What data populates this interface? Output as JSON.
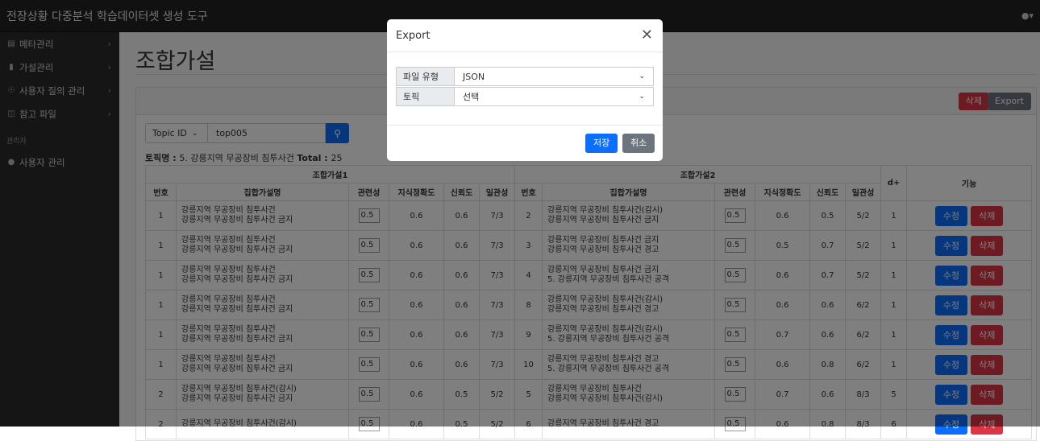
{
  "app": {
    "title": "전장상황 다중분석 학습데이터셋 생성 도구",
    "user_icon": "user-icon"
  },
  "sidebar": {
    "items": [
      {
        "label": "메타관리",
        "icon": "list-icon"
      },
      {
        "label": "가설관리",
        "icon": "bars-icon"
      },
      {
        "label": "사용자 질의 관리",
        "icon": "share-icon"
      },
      {
        "label": "참고 파일",
        "icon": "files-icon"
      }
    ],
    "section_label": "관리자",
    "admin_item": {
      "label": "사용자 관리",
      "icon": "user-icon"
    }
  },
  "page": {
    "title": "조합가설"
  },
  "toolbar": {
    "delete_label": "삭제",
    "export_label": "Export"
  },
  "filter": {
    "select_value": "Topic ID",
    "input_value": "top005",
    "search_icon": "search-icon"
  },
  "topic": {
    "label": "토픽명 : ",
    "name": "5. 강릉지역 무공장비 침투사건",
    "total_label": "Total : ",
    "total_value": "25"
  },
  "table": {
    "group1": "조합가설1",
    "group2": "조합가설2",
    "dplus": "d+",
    "func": "기능",
    "cols": [
      "번호",
      "집합가설명",
      "관련성",
      "지식정확도",
      "신뢰도",
      "일관성"
    ],
    "edit_label": "수정",
    "delete_label": "삭제",
    "rows": [
      {
        "n1": "1",
        "a1": "강릉지역 무공장비 침투사건",
        "b1": "강릉지역 무공장비 침투사건 금지",
        "rel1": "0.5",
        "acc1": "0.6",
        "tr1": "0.6",
        "con1": "7/3",
        "n2": "2",
        "a2": "강릉지역 무공장비 침투사건(감시)",
        "b2": "강릉지역 무공장비 침투사건 금지",
        "rel2": "0.5",
        "acc2": "0.6",
        "tr2": "0.5",
        "con2": "5/2",
        "d": "1"
      },
      {
        "n1": "1",
        "a1": "강릉지역 무공장비 침투사건",
        "b1": "강릉지역 무공장비 침투사건 금지",
        "rel1": "0.5",
        "acc1": "0.6",
        "tr1": "0.6",
        "con1": "7/3",
        "n2": "3",
        "a2": "강릉지역 무공장비 침투사건 금지",
        "b2": "강릉지역 무공장비 침투사건 경고",
        "rel2": "0.5",
        "acc2": "0.5",
        "tr2": "0.7",
        "con2": "5/2",
        "d": "1"
      },
      {
        "n1": "1",
        "a1": "강릉지역 무공장비 침투사건",
        "b1": "강릉지역 무공장비 침투사건 금지",
        "rel1": "0.5",
        "acc1": "0.6",
        "tr1": "0.6",
        "con1": "7/3",
        "n2": "4",
        "a2": "강릉지역 무공장비 침투사건 금지",
        "b2": "5. 강릉지역 무공장비 침투사건 공격",
        "rel2": "0.5",
        "acc2": "0.6",
        "tr2": "0.7",
        "con2": "5/2",
        "d": "1"
      },
      {
        "n1": "1",
        "a1": "강릉지역 무공장비 침투사건",
        "b1": "강릉지역 무공장비 침투사건 금지",
        "rel1": "0.5",
        "acc1": "0.6",
        "tr1": "0.6",
        "con1": "7/3",
        "n2": "8",
        "a2": "강릉지역 무공장비 침투사건(감시)",
        "b2": "강릉지역 무공장비 침투사건 경고",
        "rel2": "0.5",
        "acc2": "0.6",
        "tr2": "0.6",
        "con2": "6/2",
        "d": "1"
      },
      {
        "n1": "1",
        "a1": "강릉지역 무공장비 침투사건",
        "b1": "강릉지역 무공장비 침투사건 금지",
        "rel1": "0.5",
        "acc1": "0.6",
        "tr1": "0.6",
        "con1": "7/3",
        "n2": "9",
        "a2": "강릉지역 무공장비 침투사건(감시)",
        "b2": "5. 강릉지역 무공장비 침투사건 공격",
        "rel2": "0.5",
        "acc2": "0.7",
        "tr2": "0.6",
        "con2": "6/2",
        "d": "1"
      },
      {
        "n1": "1",
        "a1": "강릉지역 무공장비 침투사건",
        "b1": "강릉지역 무공장비 침투사건 금지",
        "rel1": "0.5",
        "acc1": "0.6",
        "tr1": "0.6",
        "con1": "7/3",
        "n2": "10",
        "a2": "강릉지역 무공장비 침투사건 경고",
        "b2": "5. 강릉지역 무공장비 침투사건 공격",
        "rel2": "0.5",
        "acc2": "0.6",
        "tr2": "0.8",
        "con2": "6/2",
        "d": "1"
      },
      {
        "n1": "2",
        "a1": "강릉지역 무공장비 침투사건(감시)",
        "b1": "강릉지역 무공장비 침투사건 금지",
        "rel1": "0.5",
        "acc1": "0.6",
        "tr1": "0.5",
        "con1": "5/2",
        "n2": "5",
        "a2": "강릉지역 무공장비 침투사건",
        "b2": "강릉지역 무공장비 침투사건(감시)",
        "rel2": "0.5",
        "acc2": "0.7",
        "tr2": "0.6",
        "con2": "8/3",
        "d": "5"
      },
      {
        "n1": "2",
        "a1": "강릉지역 무공장비 침투사건(감시)",
        "b1": "",
        "rel1": "0.5",
        "acc1": "0.6",
        "tr1": "0.5",
        "con1": "5/2",
        "n2": "6",
        "a2": "강릉지역 무공장비 침투사건 경고",
        "b2": "",
        "rel2": "0.5",
        "acc2": "0.6",
        "tr2": "0.8",
        "con2": "8/3",
        "d": "6"
      }
    ]
  },
  "modal": {
    "title": "Export",
    "close_icon": "close-icon",
    "file_type_label": "파일 유형",
    "file_type_value": "JSON",
    "topic_label": "토픽",
    "topic_value": "선택",
    "save_label": "저장",
    "cancel_label": "취소"
  }
}
